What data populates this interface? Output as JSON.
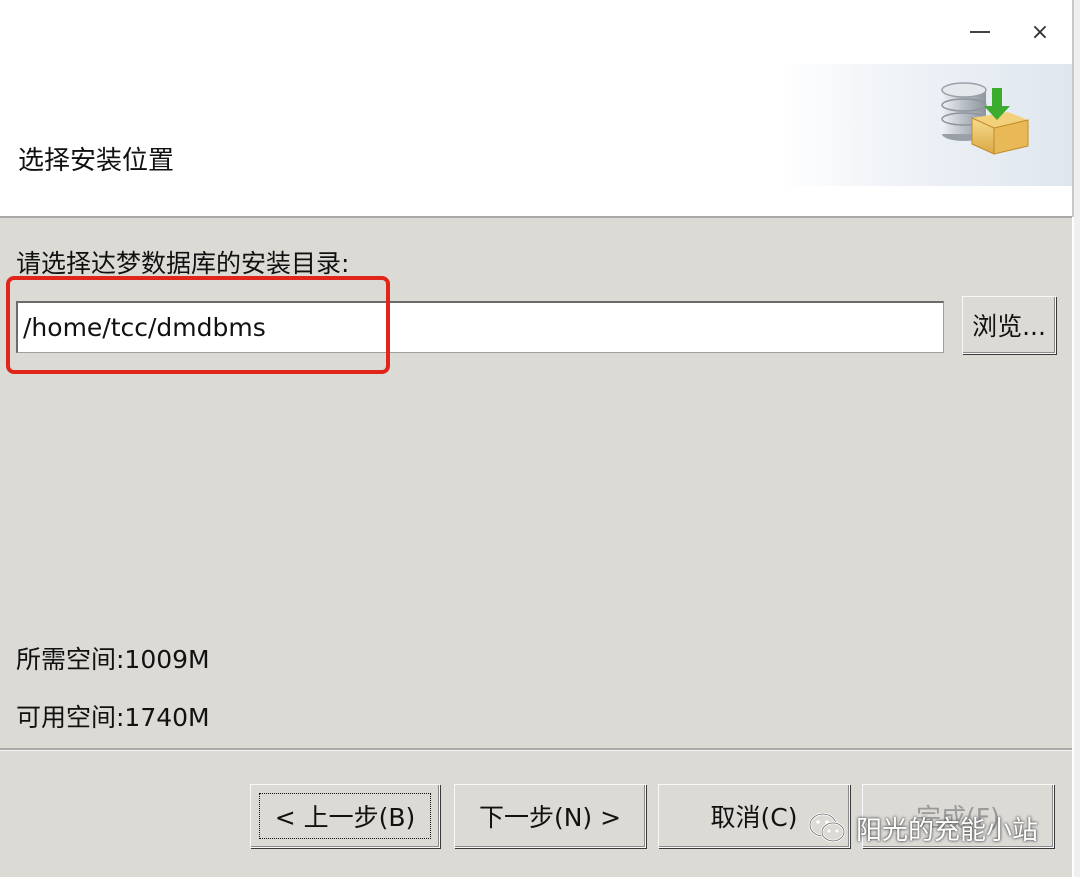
{
  "window": {
    "minimize_glyph": "minimize-icon",
    "close_glyph": "×"
  },
  "header": {
    "title": "选择安装位置",
    "icon": "database-install-icon"
  },
  "main": {
    "prompt": "请选择达梦数据库的安装目录:",
    "install_path": "/home/tcc/dmdbms",
    "browse_label": "浏览...",
    "required_space": "所需空间:1009M",
    "available_space": "可用空间:1740M"
  },
  "footer": {
    "back_label": "< 上一步(B)",
    "next_label": "下一步(N) >",
    "cancel_label": "取消(C)",
    "finish_label": "完成(F)"
  },
  "watermark": {
    "text": "阳光的充能小站",
    "icon": "wechat-icon"
  },
  "colors": {
    "dialog_bg": "#dcdad5",
    "highlight": "#e0251b"
  }
}
